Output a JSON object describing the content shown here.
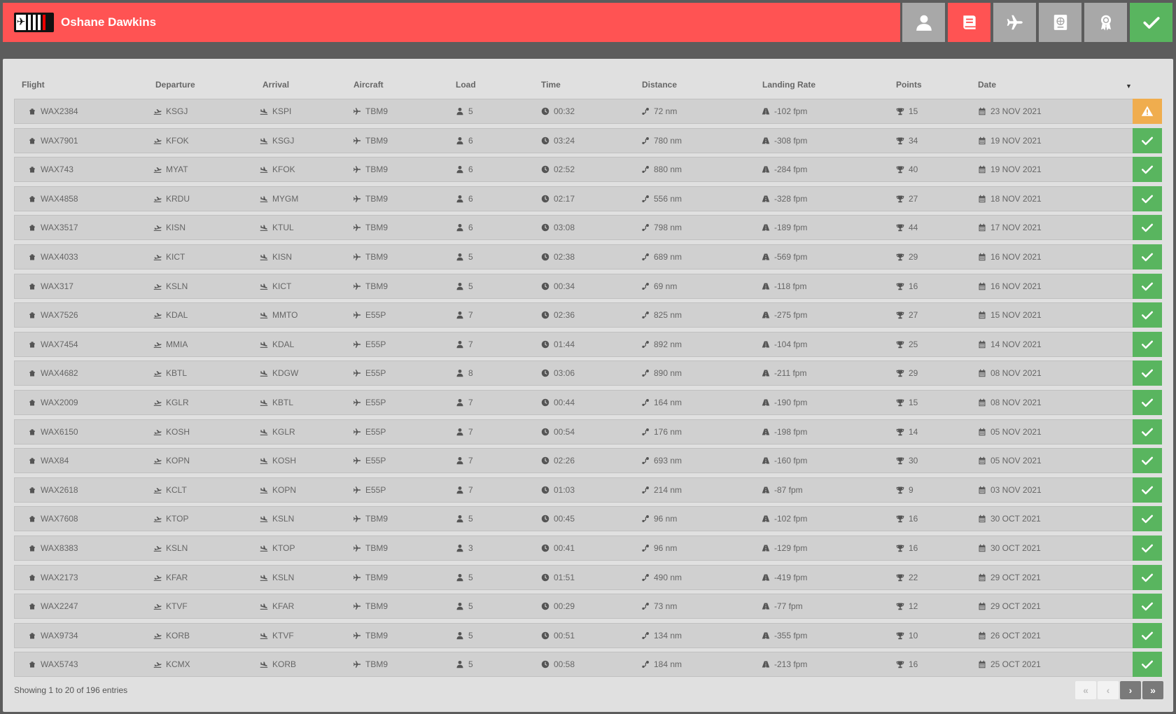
{
  "header": {
    "pilot_name": "Oshane Dawkins",
    "logo_icon": "airline-logo-icon",
    "nav": [
      {
        "name": "profile-icon",
        "state": "default"
      },
      {
        "name": "logbook-icon",
        "state": "active"
      },
      {
        "name": "airplane-icon",
        "state": "default"
      },
      {
        "name": "passport-icon",
        "state": "default"
      },
      {
        "name": "award-icon",
        "state": "default"
      },
      {
        "name": "check-icon",
        "state": "ok"
      }
    ]
  },
  "table": {
    "columns": [
      "Flight",
      "Departure",
      "Arrival",
      "Aircraft",
      "Load",
      "Time",
      "Distance",
      "Landing Rate",
      "Points",
      "Date"
    ],
    "rows": [
      {
        "flight": "WAX2384",
        "dep": "KSGJ",
        "arr": "KSPI",
        "aircraft": "TBM9",
        "load": "5",
        "time": "00:32",
        "distance": "72 nm",
        "rate": "-102 fpm",
        "points": "15",
        "date": "23 NOV 2021",
        "status": "warning"
      },
      {
        "flight": "WAX7901",
        "dep": "KFOK",
        "arr": "KSGJ",
        "aircraft": "TBM9",
        "load": "6",
        "time": "03:24",
        "distance": "780 nm",
        "rate": "-308 fpm",
        "points": "34",
        "date": "19 NOV 2021",
        "status": "accepted"
      },
      {
        "flight": "WAX743",
        "dep": "MYAT",
        "arr": "KFOK",
        "aircraft": "TBM9",
        "load": "6",
        "time": "02:52",
        "distance": "880 nm",
        "rate": "-284 fpm",
        "points": "40",
        "date": "19 NOV 2021",
        "status": "accepted"
      },
      {
        "flight": "WAX4858",
        "dep": "KRDU",
        "arr": "MYGM",
        "aircraft": "TBM9",
        "load": "6",
        "time": "02:17",
        "distance": "556 nm",
        "rate": "-328 fpm",
        "points": "27",
        "date": "18 NOV 2021",
        "status": "accepted"
      },
      {
        "flight": "WAX3517",
        "dep": "KISN",
        "arr": "KTUL",
        "aircraft": "TBM9",
        "load": "6",
        "time": "03:08",
        "distance": "798 nm",
        "rate": "-189 fpm",
        "points": "44",
        "date": "17 NOV 2021",
        "status": "accepted"
      },
      {
        "flight": "WAX4033",
        "dep": "KICT",
        "arr": "KISN",
        "aircraft": "TBM9",
        "load": "5",
        "time": "02:38",
        "distance": "689 nm",
        "rate": "-569 fpm",
        "points": "29",
        "date": "16 NOV 2021",
        "status": "accepted"
      },
      {
        "flight": "WAX317",
        "dep": "KSLN",
        "arr": "KICT",
        "aircraft": "TBM9",
        "load": "5",
        "time": "00:34",
        "distance": "69 nm",
        "rate": "-118 fpm",
        "points": "16",
        "date": "16 NOV 2021",
        "status": "accepted"
      },
      {
        "flight": "WAX7526",
        "dep": "KDAL",
        "arr": "MMTO",
        "aircraft": "E55P",
        "load": "7",
        "time": "02:36",
        "distance": "825 nm",
        "rate": "-275 fpm",
        "points": "27",
        "date": "15 NOV 2021",
        "status": "accepted"
      },
      {
        "flight": "WAX7454",
        "dep": "MMIA",
        "arr": "KDAL",
        "aircraft": "E55P",
        "load": "7",
        "time": "01:44",
        "distance": "892 nm",
        "rate": "-104 fpm",
        "points": "25",
        "date": "14 NOV 2021",
        "status": "accepted"
      },
      {
        "flight": "WAX4682",
        "dep": "KBTL",
        "arr": "KDGW",
        "aircraft": "E55P",
        "load": "8",
        "time": "03:06",
        "distance": "890 nm",
        "rate": "-211 fpm",
        "points": "29",
        "date": "08 NOV 2021",
        "status": "accepted"
      },
      {
        "flight": "WAX2009",
        "dep": "KGLR",
        "arr": "KBTL",
        "aircraft": "E55P",
        "load": "7",
        "time": "00:44",
        "distance": "164 nm",
        "rate": "-190 fpm",
        "points": "15",
        "date": "08 NOV 2021",
        "status": "accepted"
      },
      {
        "flight": "WAX6150",
        "dep": "KOSH",
        "arr": "KGLR",
        "aircraft": "E55P",
        "load": "7",
        "time": "00:54",
        "distance": "176 nm",
        "rate": "-198 fpm",
        "points": "14",
        "date": "05 NOV 2021",
        "status": "accepted"
      },
      {
        "flight": "WAX84",
        "dep": "KOPN",
        "arr": "KOSH",
        "aircraft": "E55P",
        "load": "7",
        "time": "02:26",
        "distance": "693 nm",
        "rate": "-160 fpm",
        "points": "30",
        "date": "05 NOV 2021",
        "status": "accepted"
      },
      {
        "flight": "WAX2618",
        "dep": "KCLT",
        "arr": "KOPN",
        "aircraft": "E55P",
        "load": "7",
        "time": "01:03",
        "distance": "214 nm",
        "rate": "-87 fpm",
        "points": "9",
        "date": "03 NOV 2021",
        "status": "accepted"
      },
      {
        "flight": "WAX7608",
        "dep": "KTOP",
        "arr": "KSLN",
        "aircraft": "TBM9",
        "load": "5",
        "time": "00:45",
        "distance": "96 nm",
        "rate": "-102 fpm",
        "points": "16",
        "date": "30 OCT 2021",
        "status": "accepted"
      },
      {
        "flight": "WAX8383",
        "dep": "KSLN",
        "arr": "KTOP",
        "aircraft": "TBM9",
        "load": "3",
        "time": "00:41",
        "distance": "96 nm",
        "rate": "-129 fpm",
        "points": "16",
        "date": "30 OCT 2021",
        "status": "accepted"
      },
      {
        "flight": "WAX2173",
        "dep": "KFAR",
        "arr": "KSLN",
        "aircraft": "TBM9",
        "load": "5",
        "time": "01:51",
        "distance": "490 nm",
        "rate": "-419 fpm",
        "points": "22",
        "date": "29 OCT 2021",
        "status": "accepted"
      },
      {
        "flight": "WAX2247",
        "dep": "KTVF",
        "arr": "KFAR",
        "aircraft": "TBM9",
        "load": "5",
        "time": "00:29",
        "distance": "73 nm",
        "rate": "-77 fpm",
        "points": "12",
        "date": "29 OCT 2021",
        "status": "accepted"
      },
      {
        "flight": "WAX9734",
        "dep": "KORB",
        "arr": "KTVF",
        "aircraft": "TBM9",
        "load": "5",
        "time": "00:51",
        "distance": "134 nm",
        "rate": "-355 fpm",
        "points": "10",
        "date": "26 OCT 2021",
        "status": "accepted"
      },
      {
        "flight": "WAX5743",
        "dep": "KCMX",
        "arr": "KORB",
        "aircraft": "TBM9",
        "load": "5",
        "time": "00:58",
        "distance": "184 nm",
        "rate": "-213 fpm",
        "points": "16",
        "date": "25 OCT 2021",
        "status": "accepted"
      }
    ]
  },
  "footer": {
    "info": "Showing 1 to 20 of 196 entries",
    "pager": [
      {
        "label": "«",
        "name": "first-page-button",
        "enabled": false
      },
      {
        "label": "‹",
        "name": "prev-page-button",
        "enabled": false
      },
      {
        "label": "›",
        "name": "next-page-button",
        "enabled": true
      },
      {
        "label": "»",
        "name": "last-page-button",
        "enabled": true
      }
    ]
  },
  "colors": {
    "header_red": "#ff5353",
    "nav_gray": "#a8a8a8",
    "status_ok": "#59b55f",
    "status_warn": "#f0ad4e"
  }
}
